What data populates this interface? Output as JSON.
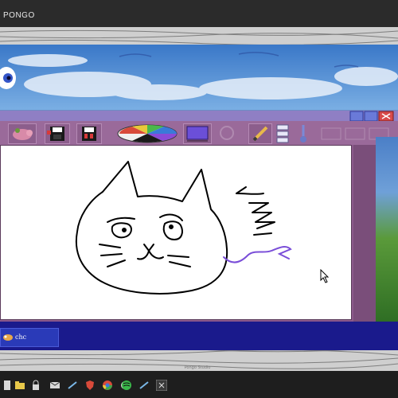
{
  "host_window": {
    "title": "PONGO"
  },
  "app_taskbar": {
    "item_label": "chc"
  },
  "host_footer": {
    "caption": "Pongo Studio"
  },
  "colors": {
    "app_background": "#8a5c8a",
    "toolbar": "#9a6a9a",
    "canvas": "#ffffff",
    "taskbar": "#1a1a8c",
    "drawing_stroke": "#000000",
    "accent_stroke": "#7a4ed8",
    "selected_color": "#6b4fd8"
  },
  "toolbar": {
    "buttons": [
      {
        "icon": "pig-icon"
      },
      {
        "icon": "save-icon"
      },
      {
        "icon": "save-as-icon"
      },
      {
        "icon": "color-wheel-icon"
      },
      {
        "icon": "selected-color-swatch"
      },
      {
        "icon": "eraser-icon"
      },
      {
        "icon": "pencil-icon"
      },
      {
        "icon": "menu-list-icon"
      },
      {
        "icon": "brush-icon"
      },
      {
        "icon": "window-controls-icon"
      }
    ]
  },
  "host_taskbar_icons": [
    "file-icon",
    "folder-icon",
    "lock-icon",
    "mail-icon",
    "steam-icon",
    "shield-icon",
    "chrome-icon",
    "circle-icon",
    "spotify-icon",
    "steam-icon-2",
    "app-icon"
  ]
}
